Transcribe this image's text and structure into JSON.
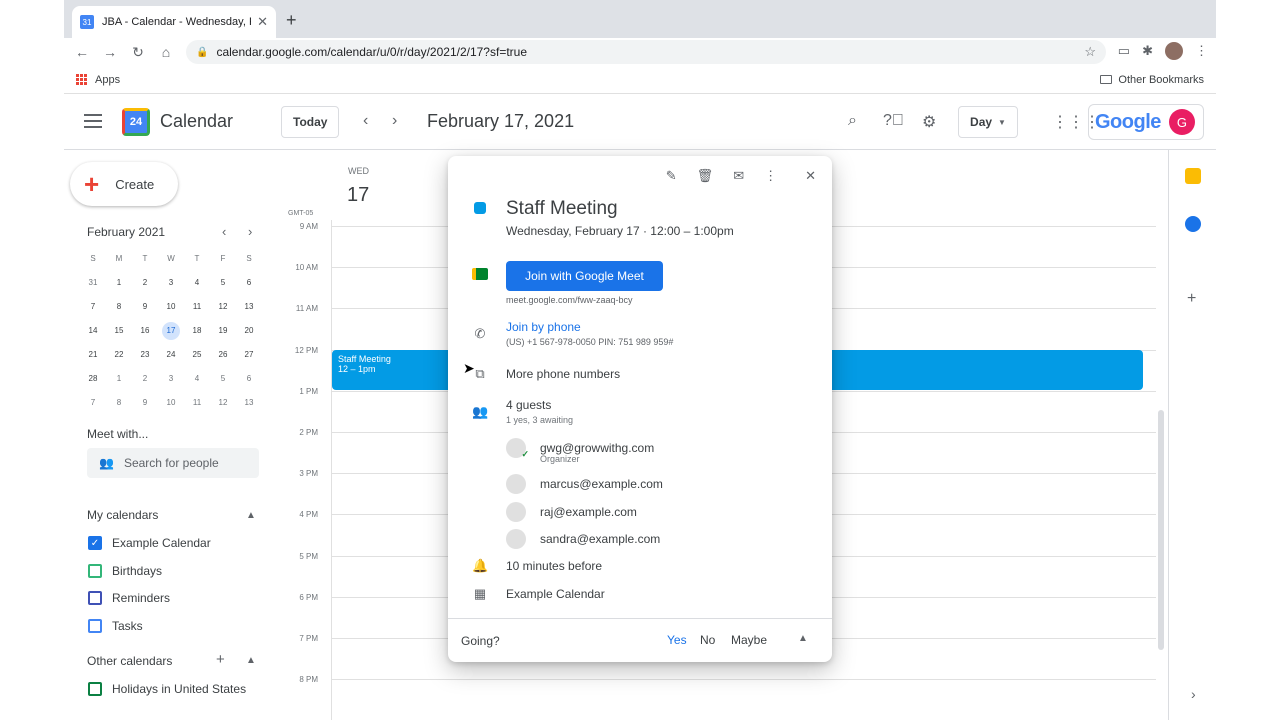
{
  "browser": {
    "tab_title": "JBA - Calendar - Wednesday, F",
    "url": "calendar.google.com/calendar/u/0/r/day/2021/2/17?sf=true",
    "apps_label": "Apps",
    "other_bookmarks": "Other Bookmarks"
  },
  "header": {
    "app_name": "Calendar",
    "logo_num": "24",
    "today_label": "Today",
    "date_title": "February 17, 2021",
    "view_label": "Day",
    "google_word": "Google",
    "avatar_letter": "G"
  },
  "sidebar": {
    "create_label": "Create",
    "mini_title": "February 2021",
    "weekday_heads": [
      "S",
      "M",
      "T",
      "W",
      "T",
      "F",
      "S"
    ],
    "mini_days": [
      "31",
      "1",
      "2",
      "3",
      "4",
      "5",
      "6",
      "7",
      "8",
      "9",
      "10",
      "11",
      "12",
      "13",
      "14",
      "15",
      "16",
      "17",
      "18",
      "19",
      "20",
      "21",
      "22",
      "23",
      "24",
      "25",
      "26",
      "27",
      "28",
      "1",
      "2",
      "3",
      "4",
      "5",
      "6",
      "7",
      "8",
      "9",
      "10",
      "11",
      "12",
      "13"
    ],
    "meet_with": "Meet with...",
    "search_people": "Search for people",
    "my_calendars": "My calendars",
    "calendars": [
      {
        "label": "Example Calendar",
        "color": "#1a73e8",
        "checked": true
      },
      {
        "label": "Birthdays",
        "color": "#33b679",
        "checked": false
      },
      {
        "label": "Reminders",
        "color": "#3f51b5",
        "checked": false
      },
      {
        "label": "Tasks",
        "color": "#4285f4",
        "checked": false
      }
    ],
    "other_calendars": "Other calendars",
    "other": [
      {
        "label": "Holidays in United States",
        "color": "#0b8043",
        "checked": false
      }
    ]
  },
  "grid": {
    "timezone": "GMT-05",
    "day_name": "WED",
    "day_num": "17",
    "hours": [
      "9 AM",
      "10 AM",
      "11 AM",
      "12 PM",
      "1 PM",
      "2 PM",
      "3 PM",
      "4 PM",
      "5 PM",
      "6 PM",
      "7 PM",
      "8 PM"
    ],
    "event_title": "Staff Meeting",
    "event_time": "12 – 1pm"
  },
  "popup": {
    "title": "Staff Meeting",
    "when": "Wednesday, February 17 · 12:00 – 1:00pm",
    "meet_button": "Join with Google Meet",
    "meet_link": "meet.google.com/fww-zaaq-bcy",
    "join_phone": "Join by phone",
    "phone_pin": "(US) +1 567-978-0050 PIN: 751 989 959#",
    "more_phone": "More phone numbers",
    "guests_count": "4 guests",
    "guests_status": "1 yes, 3 awaiting",
    "guests": [
      {
        "email": "gwg@growwithg.com",
        "role": "Organizer"
      },
      {
        "email": "marcus@example.com",
        "role": ""
      },
      {
        "email": "raj@example.com",
        "role": ""
      },
      {
        "email": "sandra@example.com",
        "role": ""
      }
    ],
    "reminder": "10 minutes before",
    "calendar": "Example Calendar",
    "going": "Going?",
    "yes": "Yes",
    "no": "No",
    "maybe": "Maybe"
  }
}
